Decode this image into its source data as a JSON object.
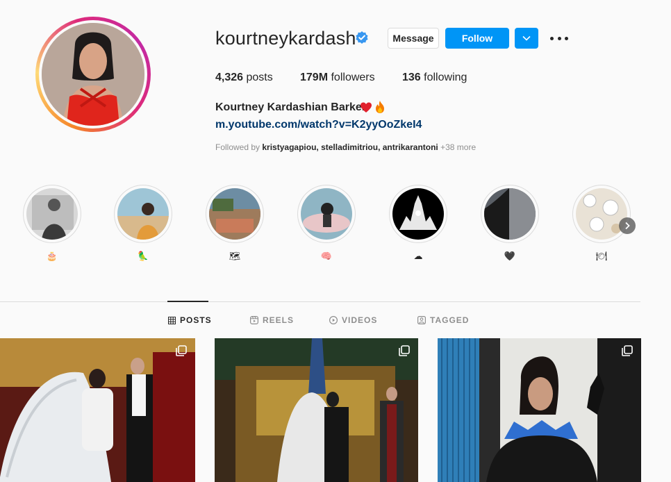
{
  "profile": {
    "username": "kourtneykardash",
    "full_name": "Kourtney Kardashian Barker",
    "link": "m.youtube.com/watch?v=K2yyOoZkeI4",
    "stats": {
      "posts_count": "4,326",
      "posts_label": "posts",
      "followers_count": "179M",
      "followers_label": "followers",
      "following_count": "136",
      "following_label": "following"
    },
    "followed_by_prefix": "Followed by",
    "followed_by_names": "kristyagapiou, stelladimitriou, antrikarantoni",
    "followed_by_more": "+38 more"
  },
  "actions": {
    "message_label": "Message",
    "follow_label": "Follow"
  },
  "highlights": [
    {
      "label": "🎂"
    },
    {
      "label": "🦜"
    },
    {
      "label": "🗺"
    },
    {
      "label": "🧠"
    },
    {
      "label": "☁"
    },
    {
      "label": "🖤"
    },
    {
      "label": "🍽"
    }
  ],
  "tabs": [
    {
      "label": "POSTS",
      "icon": "grid-icon",
      "active": true
    },
    {
      "label": "REELS",
      "icon": "reels-icon"
    },
    {
      "label": "VIDEOS",
      "icon": "video-icon"
    },
    {
      "label": "TAGGED",
      "icon": "tagged-icon"
    }
  ],
  "colors": {
    "accent": "#0095f6",
    "link": "#00376b",
    "muted": "#8e8e8e",
    "border": "#dbdbdb",
    "background": "#fafafa"
  }
}
